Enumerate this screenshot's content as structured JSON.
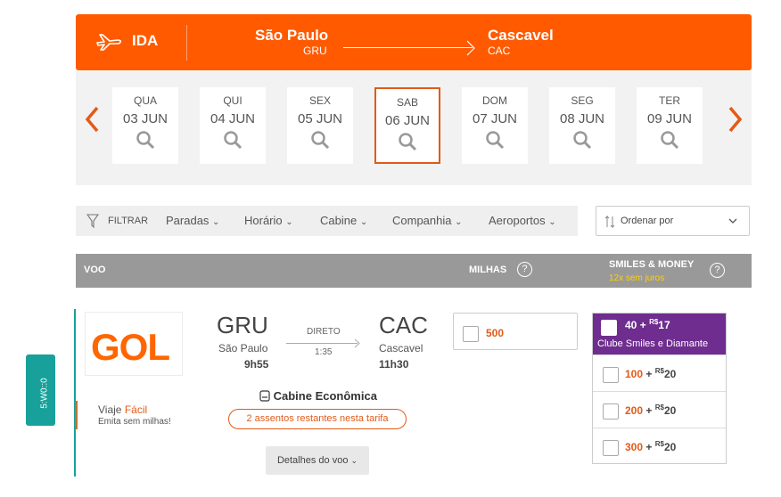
{
  "header": {
    "direction": "IDA",
    "origin_city": "São Paulo",
    "origin_code": "GRU",
    "destination_city": "Cascavel",
    "destination_code": "CAC",
    "color": "#ff5a00"
  },
  "dates": [
    {
      "weekday": "QUA",
      "date": "03 JUN",
      "selected": false
    },
    {
      "weekday": "QUI",
      "date": "04 JUN",
      "selected": false
    },
    {
      "weekday": "SEX",
      "date": "05 JUN",
      "selected": false
    },
    {
      "weekday": "SAB",
      "date": "06 JUN",
      "selected": true
    },
    {
      "weekday": "DOM",
      "date": "07 JUN",
      "selected": false
    },
    {
      "weekday": "SEG",
      "date": "08 JUN",
      "selected": false
    },
    {
      "weekday": "TER",
      "date": "09 JUN",
      "selected": false
    }
  ],
  "filters": {
    "filter_label": "FILTRAR",
    "stops": "Paradas",
    "time": "Horário",
    "cabin": "Cabine",
    "airline": "Companhia",
    "airports": "Aeroportos",
    "sort_label": "Ordenar por"
  },
  "table_header": {
    "flight": "VOO",
    "miles": "MILHAS",
    "smiles_money": "SMILES & MONEY",
    "installments": "12x sem juros",
    "help_glyph": "?"
  },
  "flight": {
    "airline_logo": "GOL",
    "badge_prefix": "Viaje",
    "badge_highlight": "Fácil",
    "badge_sub": "Emita sem milhas!",
    "origin_code": "GRU",
    "origin_city": "São Paulo",
    "departure": "9h55",
    "stops": "DIRETO",
    "duration": "1:35",
    "destination_code": "CAC",
    "destination_city": "Cascavel",
    "arrival": "11h30",
    "cabin": "Cabine Econômica",
    "seats_left": "2 assentos restantes nesta tarifa",
    "details_button": "Detalhes do voo",
    "miles_price": "500",
    "smiles_money_featured": {
      "miles": "40",
      "plus": "+",
      "currency": "R$",
      "cash": "17",
      "label": "Clube Smiles e Diamante"
    },
    "smiles_money_options": [
      {
        "miles": "100",
        "plus": "+",
        "currency": "R$",
        "cash": "20"
      },
      {
        "miles": "200",
        "plus": "+",
        "currency": "R$",
        "cash": "20"
      },
      {
        "miles": "300",
        "plus": "+",
        "currency": "R$",
        "cash": "20"
      }
    ]
  },
  "side_tab": "5:W0::0",
  "colors": {
    "orange": "#ff5a00",
    "accent": "#e35a17",
    "teal": "#17a19a",
    "purple": "#6e2d8f",
    "yellow": "#ffd200",
    "gray_header": "#999999"
  }
}
